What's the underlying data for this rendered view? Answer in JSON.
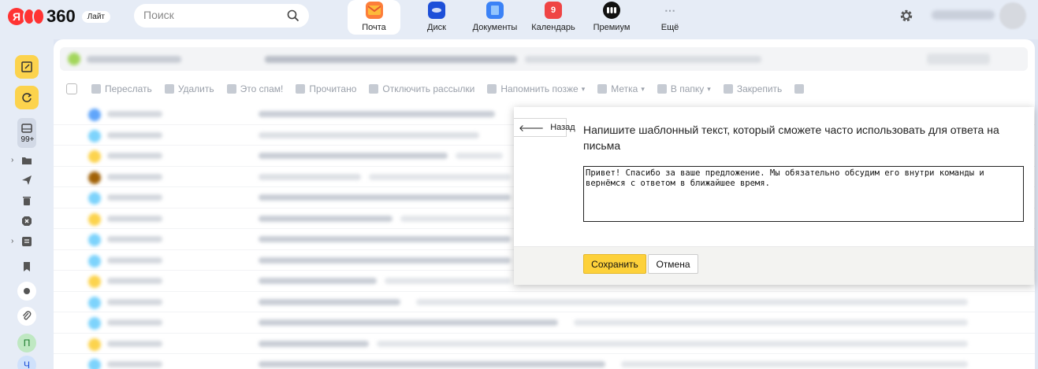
{
  "header": {
    "logo_text": "360",
    "logo_letter": "Я",
    "plan_badge": "Лайт",
    "search_placeholder": "Поиск",
    "apps": [
      {
        "label": "Почта",
        "icon": "mail-icon",
        "color": "#fd7e3a",
        "active": true
      },
      {
        "label": "Диск",
        "icon": "disk-icon",
        "color": "#1d4fd8"
      },
      {
        "label": "Документы",
        "icon": "documents-icon",
        "color": "#3b82f6"
      },
      {
        "label": "Календарь",
        "icon": "calendar-icon",
        "color": "#ef4444",
        "badge": "9"
      },
      {
        "label": "Премиум",
        "icon": "premium-icon",
        "color": "#111111"
      },
      {
        "label": "Ещё",
        "icon": "more-icon",
        "color": "#9aa0aa"
      }
    ]
  },
  "sidebar": {
    "inbox_count": "99+",
    "circles": [
      "П",
      "Ч"
    ]
  },
  "toolbar": {
    "items": [
      {
        "label": "Переслать",
        "caret": false
      },
      {
        "label": "Удалить",
        "caret": false
      },
      {
        "label": "Это спам!",
        "caret": false
      },
      {
        "label": "Прочитано",
        "caret": false
      },
      {
        "label": "Отключить рассылки",
        "caret": false
      },
      {
        "label": "Напомнить позже",
        "caret": true
      },
      {
        "label": "Метка",
        "caret": true
      },
      {
        "label": "В папку",
        "caret": true
      },
      {
        "label": "Закрепить",
        "caret": false
      }
    ]
  },
  "dialog": {
    "back_label": "Назад",
    "title": "Напишите шаблонный текст, который сможете часто использовать для ответа на письма",
    "template_text": "Привет! Спасибо за ваше предложение. Мы обязательно обсудим его внутри команды и вернёмся с ответом в ближайшее время.",
    "save_label": "Сохранить",
    "cancel_label": "Отмена"
  },
  "colors": {
    "accent_yellow": "#fdd13a",
    "brand_red": "#ff3333"
  }
}
